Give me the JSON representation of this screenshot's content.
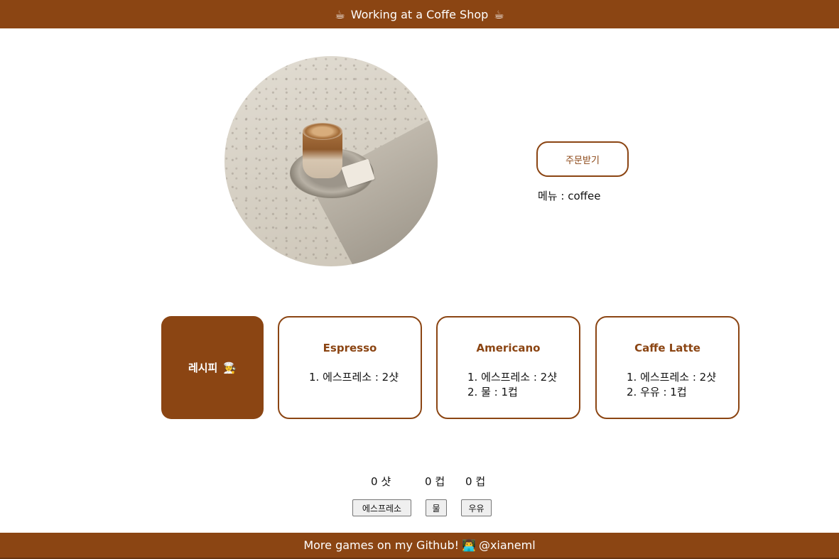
{
  "header": {
    "title": "Working at a Coffe Shop",
    "emoji_left": "☕",
    "emoji_right": "☕"
  },
  "order": {
    "button_label": "주문받기",
    "menu_label": "메뉴 : ",
    "menu_value": "coffee"
  },
  "recipes": {
    "title": "레시피",
    "title_emoji": "🧑‍🍳",
    "items": [
      {
        "name": "Espresso",
        "steps": [
          "1. 에스프레소 : 2샷"
        ]
      },
      {
        "name": "Americano",
        "steps": [
          "1. 에스프레소 : 2샷",
          "2. 물 : 1컵"
        ]
      },
      {
        "name": "Caffe Latte",
        "steps": [
          "1. 에스프레소 : 2샷",
          "2. 우유 : 1컵"
        ]
      }
    ]
  },
  "ingredients": {
    "counts": [
      {
        "value": "0",
        "unit": "샷"
      },
      {
        "value": "0",
        "unit": "컵"
      },
      {
        "value": "0",
        "unit": "컵"
      }
    ],
    "buttons": [
      "에스프레소",
      "물",
      "우유"
    ]
  },
  "footer": {
    "text": "More games on my Github!",
    "emoji": "👨‍💻",
    "handle": "@xianeml"
  },
  "colors": {
    "brand": "#8b4513",
    "background": "#ffffff"
  }
}
